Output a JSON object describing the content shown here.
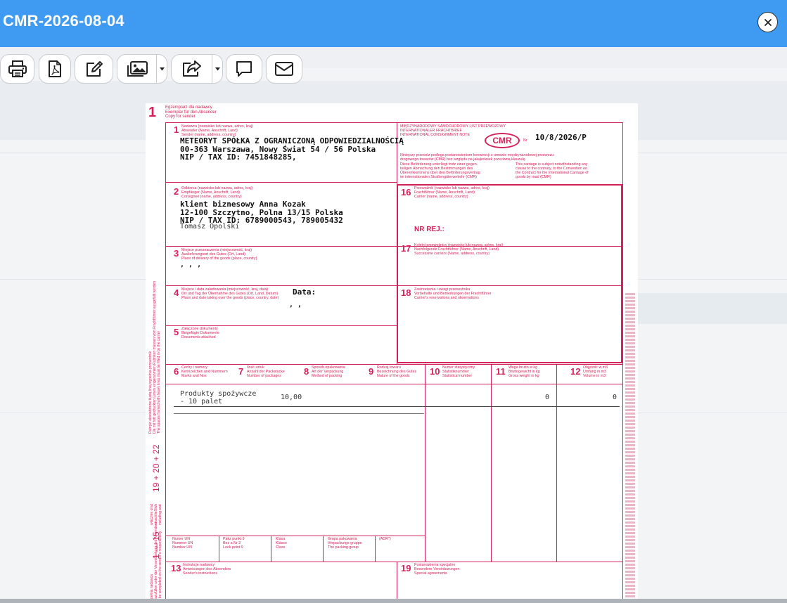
{
  "modal": {
    "title": "CMR-2026-08-04",
    "close_icon": "close-icon"
  },
  "toolbar": {
    "buttons": [
      {
        "name": "print-button",
        "icon": "printer-icon"
      },
      {
        "name": "pdf-button",
        "icon": "pdf-file-icon"
      },
      {
        "name": "edit-button",
        "icon": "edit-icon"
      },
      {
        "name": "image-button",
        "icon": "image-icon",
        "dropdown": true
      },
      {
        "name": "share-button",
        "icon": "share-icon",
        "dropdown": true
      },
      {
        "name": "comment-button",
        "icon": "comment-icon"
      },
      {
        "name": "email-button",
        "icon": "envelope-icon"
      }
    ]
  },
  "colors": {
    "header": "#3f9bf1",
    "form_pink": "#d5215a"
  },
  "document": {
    "copy_number": "1",
    "copy_label": [
      "Egzemplarz dla nadawcy",
      "Exemplar für den Absender",
      "Copy for sender"
    ],
    "box1": {
      "num": "1",
      "label": [
        "Nadawca (nazwisko lub nazwa, adres, kraj)",
        "Absender (Name, Anschrift, Land)",
        "Sender (name, address, country)"
      ],
      "lines": [
        "METEORYT SPÓŁKA Z OGRANICZONĄ ODPOWIEDZIALNOŚCIĄ",
        "00-363 Warszawa, Nowy Świat 54 / 56 Polska",
        "NIP / TAX ID: 7451848285,"
      ]
    },
    "header_right": {
      "label": [
        "MIĘDZYNARODOWY SAMOCHODOWY LIST PRZEWOZOWY",
        "INTERNATIONALER FRACHTBRIEF",
        "INTERNATIONAL CONSIGNMENT NOTE"
      ],
      "logo": "CMR",
      "nr_label": "Nr",
      "number": "10/8/2026/P",
      "notice_pl": [
        "Niniejszy przewóz podlega postanowieniom konwencji o umowie międzynarodowej przewozu",
        "drogowego towarów (CMR) bez względu na jakąkolwiek przeciwną klauzulę."
      ],
      "notice_de": [
        "Diese Beförderung unterliegt trotz einer gegen-",
        "teiligen Abmachung den Bestimmungen des",
        "Übereinkommens über den Beförderungsvertrag",
        "im internationalen Straßengüterverkehr (CMR)"
      ],
      "notice_en": [
        "This carriage is subject notwithstanding any",
        "clause to the contrary, to the Convention on",
        "the Contract for the International Carriage of",
        "goods by road (CMR)"
      ]
    },
    "box2": {
      "num": "2",
      "label": [
        "Odbiorca (nazwisko lub nazwa, adres, kraj)",
        "Empfänger (Name, Anschrift, Land)",
        "Consignee (name, address, country)"
      ],
      "lines": [
        "klient biznesowy Anna Kozak",
        "12-100 Szczytno, Polna 13/15 Polska",
        "NIP / TAX ID: 6789000543, 789005432"
      ],
      "contact": "Tomasz Opolski"
    },
    "box16": {
      "num": "16",
      "label": [
        "Przewoźnik (nazwisko lub nazwa, adres, kraj)",
        "Frachtführer (Name, Anschrift, Land)",
        "Carrier (name, address, country)"
      ],
      "nr_rej": "NR REJ.:"
    },
    "box17": {
      "num": "17",
      "label": [
        "Kolejni przewoźnicy (nazwisko lub nazwa, adres, kraj)",
        "Nachfolgende Frachtführer (Name, Anschrift, Land)",
        "Successive carriers (Name, address, country)"
      ]
    },
    "box3": {
      "num": "3",
      "label": [
        "Miejsce przeznaczenia (miejscowość, kraj)",
        "Auslieferungsort des Gutes (Ort, Land)",
        "Place of delivery of the goods (place, country)"
      ],
      "value": ", , ,"
    },
    "box4": {
      "num": "4",
      "label": [
        "Miejsce i data załadowania (miejscowość, kraj, data)",
        "Ort und Tag der Übernahme des Gutes (Ort, Land, Datum)",
        "Place and date taking over the goods (place, country, date)"
      ],
      "data_label": "Data:",
      "value": ", ,"
    },
    "box18": {
      "num": "18",
      "label": [
        "Zastrzeżenia i uwagi przewoźnika",
        "Vorbehalte und Bemerkungen der Frachtführer",
        "Carrier's reservations and observations"
      ]
    },
    "box5": {
      "num": "5",
      "label": [
        "Załączone dokumenty",
        "Beigefügte Dokumente",
        "Documents attached"
      ]
    },
    "columns": [
      {
        "num": "6",
        "label": [
          "Cechy i numery",
          "Kennzeichen und Nummern",
          "Marks and Nos"
        ]
      },
      {
        "num": "7",
        "label": [
          "Ilość sztuk",
          "Anzahl der Packstücke",
          "Number of packages"
        ]
      },
      {
        "num": "8",
        "label": [
          "Sposób opakowania",
          "Art der Verpackung",
          "Method of packing"
        ]
      },
      {
        "num": "9",
        "label": [
          "Rodzaj towaru",
          "Bezeichnung des Gutes",
          "Nature of the goods"
        ]
      },
      {
        "num": "10",
        "label": [
          "Numer statystyczny",
          "Statistiknummer",
          "Statistical number"
        ]
      },
      {
        "num": "11",
        "label": [
          "Waga brutto w kg",
          "Bruttogewicht in kg",
          "Gross weight in kg"
        ]
      },
      {
        "num": "12",
        "label": [
          "Objętość w m3",
          "Umfang in m3",
          "Volume in m3"
        ]
      }
    ],
    "goods": {
      "description": [
        "Produkty spożywcze",
        "- 10 palet"
      ],
      "packages": "10,00",
      "weight": "0",
      "volume": "0"
    },
    "side_numbers": {
      "range_a": "19 + 20 + 22",
      "range_b": "1 — 15"
    },
    "adr_row": [
      {
        "label": [
          "Numer UN",
          "Nummer UN",
          "Number UN"
        ]
      },
      {
        "label": [
          "Pakz punkt 9",
          "Bez a Nr 3",
          "Look point 9"
        ]
      },
      {
        "label": [
          "Klasa",
          "Klasse",
          "Class"
        ]
      },
      {
        "label": [
          "Grupa pakowania",
          "Verpackungs gruppe",
          "The packing group"
        ]
      },
      {
        "label": [
          "(ADR*)"
        ]
      }
    ],
    "box13": {
      "num": "13",
      "label": [
        "Instrukcje nadawcy",
        "Anweisungen des Absenders",
        "Sender's instructions"
      ]
    },
    "box19": {
      "num": "19",
      "label": [
        "Postanowienia specjalne",
        "Besondere Vereinbarungen",
        "Special agreements"
      ]
    },
    "left_vertical": [
      "Rubryki obwiedzione tłustą linią wypełnia przewoźnik",
      "Die mit fett gedruckten Linien eingerahmten Rubriken müssen vom Frachtführer ausgefüllt werden",
      "The spaces framed with heavy lines must be filled in by the carrier"
    ],
    "left_vertical2": [
      "włącznie oraz",
      "einschließlich",
      "including and"
    ],
    "left_vertical3": [
      "wypełnia nadawca",
      "Auszufüllen unter der Verantwortung des Absenders",
      "To be completed on the sender's responsibility"
    ]
  }
}
